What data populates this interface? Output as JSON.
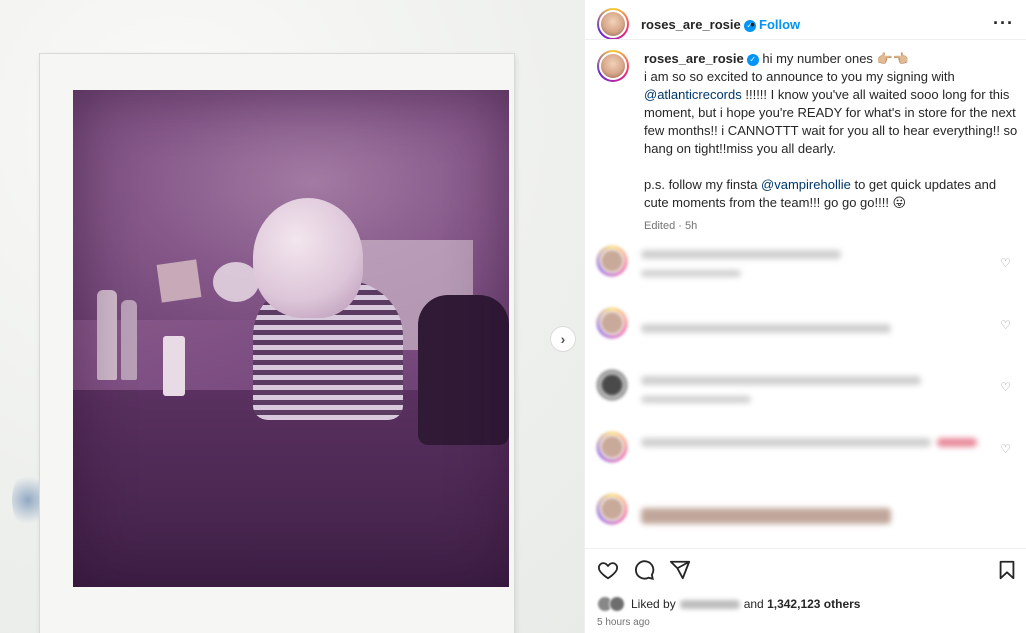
{
  "post": {
    "username": "roses_are_rosie",
    "follow_label": "Follow",
    "separator": "•",
    "more_icon": "more-horizontal-icon",
    "verified_icon": "verified-badge-icon"
  },
  "caption": {
    "username": "roses_are_rosie",
    "line1": "hi my number ones 👉🏼👈🏼",
    "line2": "i am so so excited to announce to you my signing with",
    "mention1": "@atlanticrecords",
    "line3": " !!!!!! I know you've all waited sooo long for this moment, but i hope you're READY for what's in store for the next few months!! i CANNOTTT wait for you all to hear everything!! so hang on tight!!miss you all dearly.",
    "ps_prefix": "p.s. follow my finsta ",
    "mention2": "@vampirehollie",
    "ps_suffix": " to get quick updates and cute moments from the team!!! go go go!!!! 😛",
    "edited": "Edited · 5h"
  },
  "media": {
    "next_icon": "chevron-right-icon",
    "next_glyph": "›"
  },
  "actions": {
    "like_icon": "heart-icon",
    "comment_icon": "comment-icon",
    "share_icon": "send-icon",
    "save_icon": "bookmark-icon"
  },
  "likes": {
    "prefix": "Liked by",
    "conjunction": "and",
    "count": "1,342,123 others"
  },
  "timestamp": "5 hours ago",
  "colors": {
    "accent": "#0095f6",
    "mention": "#00376b",
    "text": "#262626",
    "muted": "#737373"
  }
}
